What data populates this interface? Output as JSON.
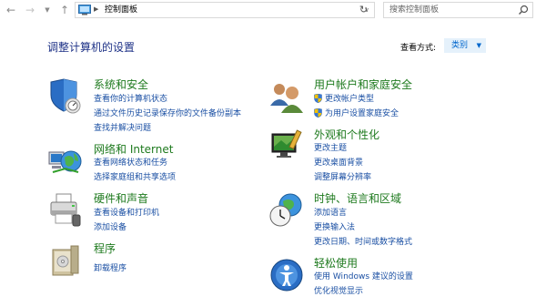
{
  "nav": {
    "address": "控制面板",
    "search_placeholder": "搜索控制面板"
  },
  "header": {
    "title": "调整计算机的设置",
    "view_by_label": "查看方式:",
    "view_by_value": "类别"
  },
  "categories": {
    "system_security": {
      "title": "系统和安全",
      "links": [
        "查看你的计算机状态",
        "通过文件历史记录保存你的文件备份副本",
        "查找并解决问题"
      ]
    },
    "network": {
      "title": "网络和 Internet",
      "links": [
        "查看网络状态和任务",
        "选择家庭组和共享选项"
      ]
    },
    "hardware": {
      "title": "硬件和声音",
      "links": [
        "查看设备和打印机",
        "添加设备"
      ]
    },
    "programs": {
      "title": "程序",
      "links": [
        "卸载程序"
      ]
    },
    "user_accounts": {
      "title": "用户帐户和家庭安全",
      "links": [
        "更改帐户类型",
        "为用户设置家庭安全"
      ]
    },
    "appearance": {
      "title": "外观和个性化",
      "links": [
        "更改主题",
        "更改桌面背景",
        "调整屏幕分辨率"
      ]
    },
    "clock": {
      "title": "时钟、语言和区域",
      "links": [
        "添加语言",
        "更换输入法",
        "更改日期、时间或数字格式"
      ]
    },
    "ease": {
      "title": "轻松使用",
      "links": [
        "使用 Windows 建议的设置",
        "优化视觉显示"
      ]
    }
  },
  "colors": {
    "title_blue": "#1e3287",
    "category_green": "#1e7a1e",
    "link_blue": "#1a4fa3",
    "accent": "#0066cc"
  }
}
